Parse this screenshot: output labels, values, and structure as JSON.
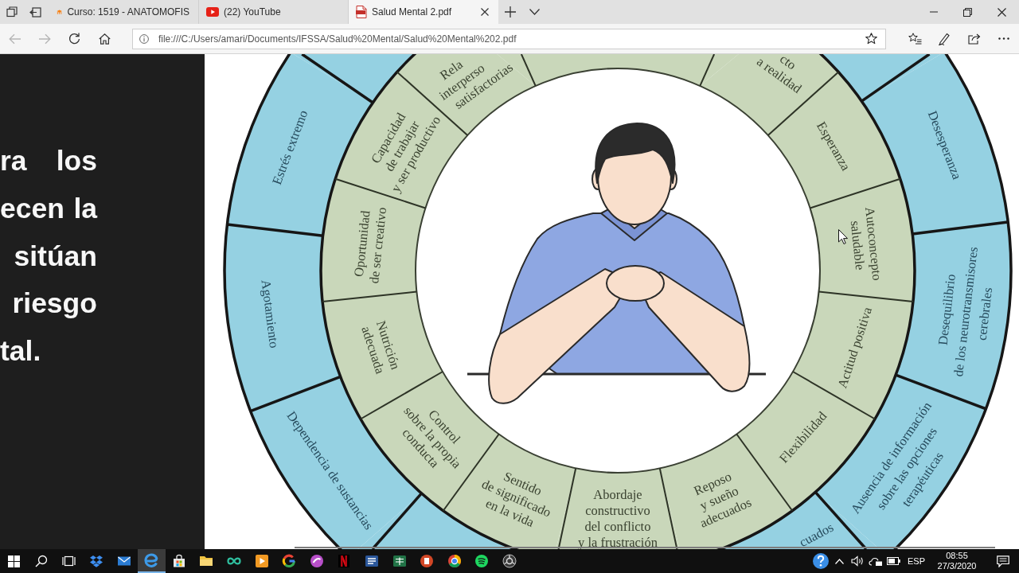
{
  "browser": {
    "tabs": [
      {
        "title": "Curso: 1519 - ANATOMOFIS",
        "selected": false
      },
      {
        "title": "(22) YouTube",
        "selected": false
      },
      {
        "title": "Salud Mental 2.pdf",
        "selected": true
      }
    ],
    "back": {
      "disabled": true
    },
    "forward": {
      "disabled": true
    },
    "address": {
      "url": "file:///C:/Users/amari/Documents/IFSSA/Salud%20Mental/Salud%20Mental%202.pdf"
    }
  },
  "slide_text": {
    "lines": [
      "ra los",
      "ecen la",
      "sitúan",
      "riesgo",
      "tal."
    ]
  },
  "wheel": {
    "inner_ring": [
      {
        "lines": [
          "Oportunidad",
          "de ser creativo"
        ]
      },
      {
        "lines": [
          "Capacidad",
          "de trabajar",
          "y ser productivo"
        ]
      },
      {
        "lines": [
          "Rela",
          "interperso",
          "satisfactorias"
        ]
      },
      {
        "lines": [
          "cto",
          "a realidad"
        ]
      },
      {
        "lines": [
          "Esperanza"
        ]
      },
      {
        "lines": [
          "Autoconcepto",
          "saludable"
        ]
      },
      {
        "lines": [
          "Actitud positiva"
        ]
      },
      {
        "lines": [
          "Flexibilidad"
        ]
      },
      {
        "lines": [
          "Reposo",
          "y sueño",
          "adecuados"
        ]
      },
      {
        "lines": [
          "Abordaje",
          "constructivo",
          "del conflicto",
          "y la frustración"
        ]
      },
      {
        "lines": [
          "Sentido",
          "de significado",
          "en la vida"
        ]
      },
      {
        "lines": [
          "Control",
          "sobre la propia",
          "conducta"
        ]
      },
      {
        "lines": [
          "Nutrición",
          "adecuada"
        ]
      }
    ],
    "outer_ring": [
      {
        "lines": [
          "Estrés extremo"
        ]
      },
      {
        "lines": [
          "Desesperanza"
        ]
      },
      {
        "lines": [
          "Desequilibrio",
          "de los neurotransmisores",
          "cerebrales"
        ]
      },
      {
        "lines": [
          "Ausencia de información",
          "sobre las opciones",
          "terapéuticas"
        ]
      },
      {
        "lines": [
          "cuados"
        ]
      },
      {
        "lines": [
          "Dependencia de sustancias"
        ]
      },
      {
        "lines": [
          "Agotamiento"
        ]
      }
    ]
  },
  "taskbar": {
    "apps": [
      {
        "selected": false
      },
      {
        "selected": false
      },
      {
        "selected": true
      },
      {
        "selected": false
      },
      {
        "selected": false
      },
      {
        "selected": false
      },
      {
        "selected": false
      },
      {
        "selected": false
      },
      {
        "selected": false
      },
      {
        "selected": false
      },
      {
        "selected": false
      },
      {
        "selected": false
      },
      {
        "selected": false
      },
      {
        "selected": false
      },
      {
        "selected": false
      },
      {
        "selected": false
      }
    ],
    "language": "ESP",
    "time": "08:55",
    "date": "27/3/2020"
  }
}
